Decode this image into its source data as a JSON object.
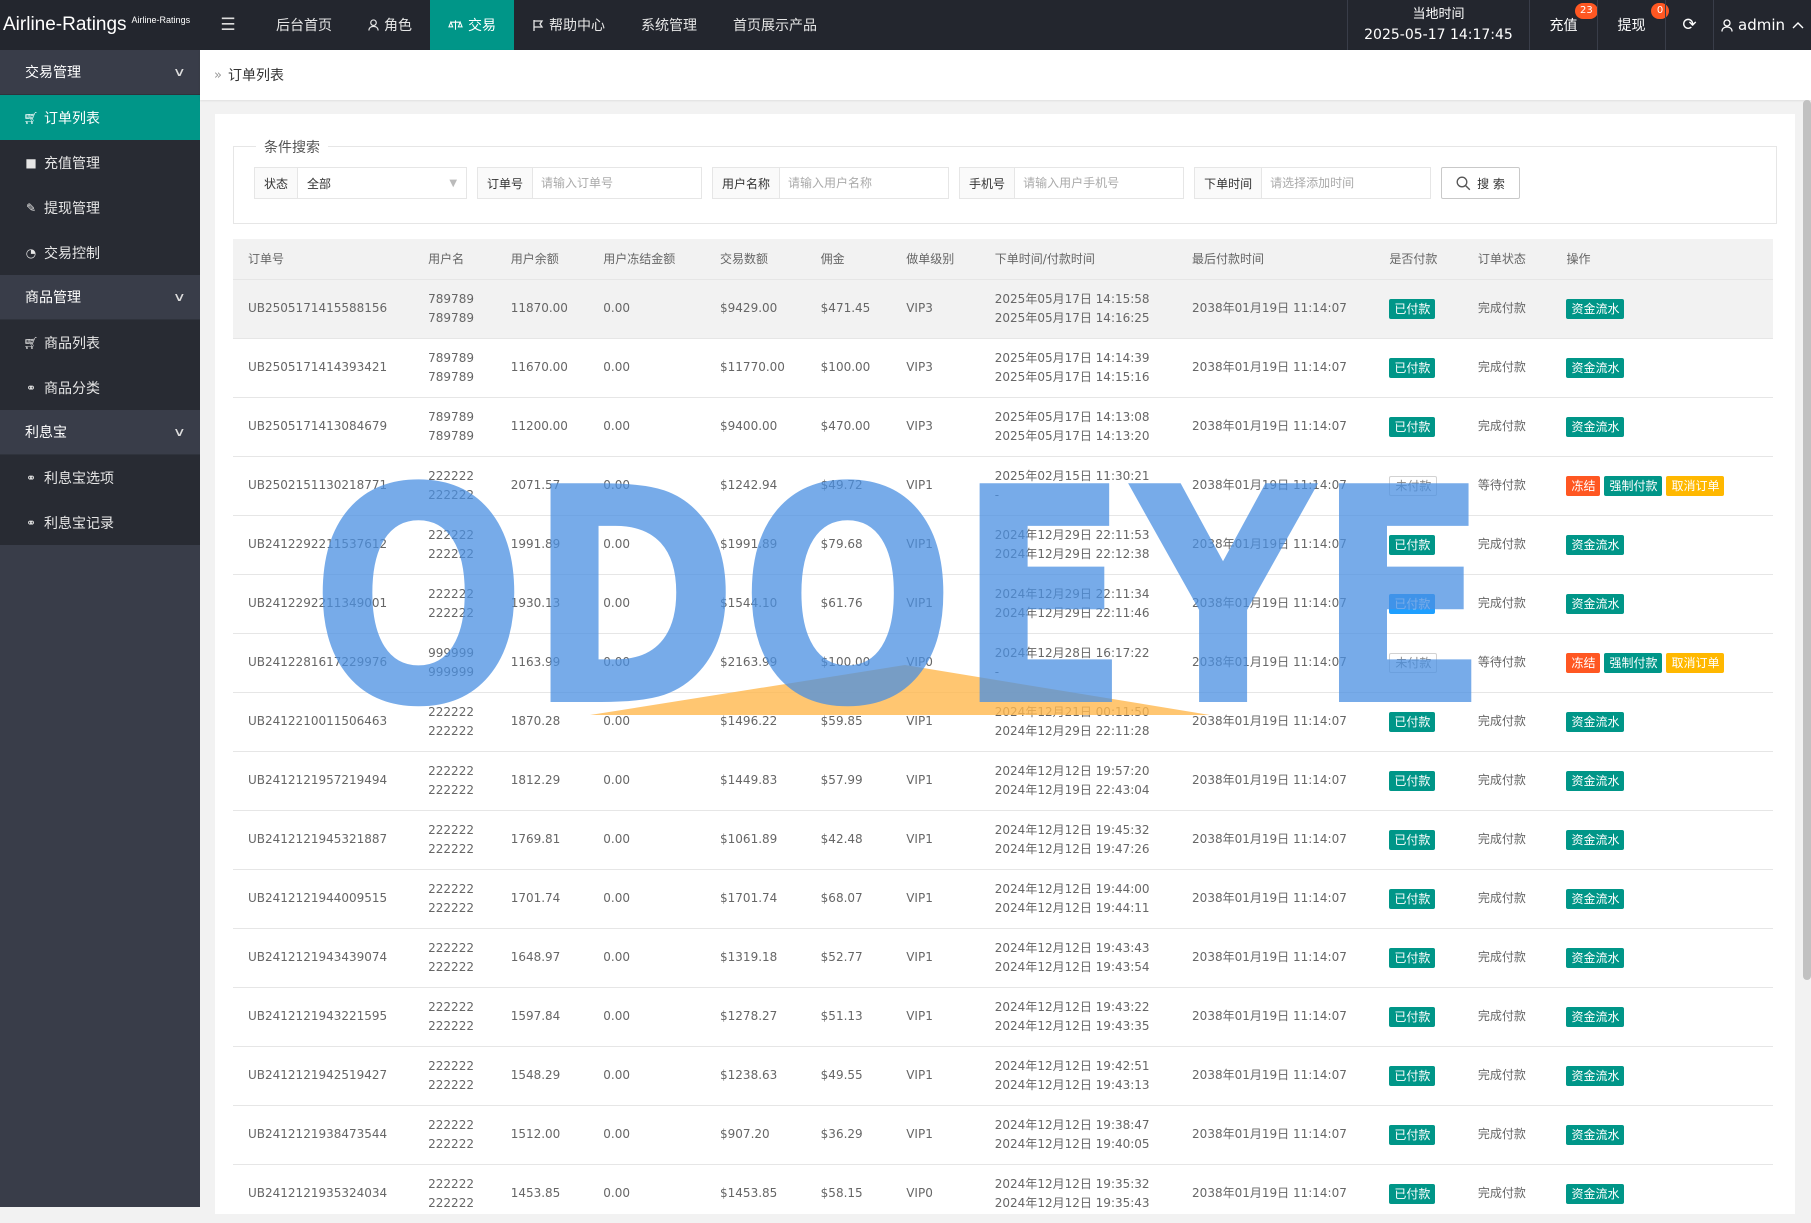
{
  "app": {
    "title": "Airline-Ratings",
    "subtitle": "Airline-Ratings"
  },
  "topnav": {
    "items": [
      {
        "label": "后台首页",
        "icon": "none"
      },
      {
        "label": "角色",
        "icon": "user-icon"
      },
      {
        "label": "交易",
        "icon": "scale-icon",
        "active": true
      },
      {
        "label": "帮助中心",
        "icon": "flag-icon"
      },
      {
        "label": "系统管理",
        "icon": "none"
      },
      {
        "label": "首页展示产品",
        "icon": "none"
      }
    ],
    "clock_label": "当地时间",
    "clock_value": "2025-05-17 14:17:45",
    "recharge_label": "充值",
    "recharge_badge": "23",
    "withdraw_label": "提现",
    "withdraw_badge": "0",
    "admin_label": "admin"
  },
  "sidebar": {
    "groups": [
      {
        "label": "交易管理",
        "items": [
          {
            "label": "订单列表",
            "icon": "cart-icon",
            "active": true
          },
          {
            "label": "充值管理",
            "icon": "comment-icon"
          },
          {
            "label": "提现管理",
            "icon": "wrench-icon"
          },
          {
            "label": "交易控制",
            "icon": "gauge-icon"
          }
        ]
      },
      {
        "label": "商品管理",
        "items": [
          {
            "label": "商品列表",
            "icon": "cart-icon"
          },
          {
            "label": "商品分类",
            "icon": "link-icon"
          }
        ]
      },
      {
        "label": "利息宝",
        "items": [
          {
            "label": "利息宝选项",
            "icon": "link-icon"
          },
          {
            "label": "利息宝记录",
            "icon": "link-icon"
          }
        ]
      }
    ]
  },
  "breadcrumb": {
    "current": "订单列表"
  },
  "filter": {
    "legend": "条件搜索",
    "status_label": "状态",
    "status_value": "全部",
    "order_label": "订单号",
    "order_placeholder": "请输入订单号",
    "username_label": "用户名称",
    "username_placeholder": "请输入用户名称",
    "phone_label": "手机号",
    "phone_placeholder": "请输入用户手机号",
    "time_label": "下单时间",
    "time_placeholder": "请选择添加时间",
    "search_label": "搜 索"
  },
  "table": {
    "headers": [
      "订单号",
      "用户名",
      "用户余额",
      "用户冻结金额",
      "交易数额",
      "佣金",
      "做单级别",
      "下单时间/付款时间",
      "最后付款时间",
      "是否付款",
      "订单状态",
      "操作"
    ],
    "rows": [
      {
        "order": "UB2505171415588156",
        "user1": "789789",
        "user2": "789789",
        "balance": "11870.00",
        "frozen": "0.00",
        "amount": "$9429.00",
        "commission": "$471.45",
        "level": "VIP3",
        "t1": "2025年05月17日 14:15:58",
        "t2": "2025年05月17日 14:16:25",
        "last": "2038年01月19日 11:14:07",
        "paid": "已付款",
        "paid_style": "green",
        "status": "完成付款",
        "actions": [
          {
            "label": "资金流水",
            "style": "green"
          }
        ]
      },
      {
        "order": "UB2505171414393421",
        "user1": "789789",
        "user2": "789789",
        "balance": "11670.00",
        "frozen": "0.00",
        "amount": "$11770.00",
        "commission": "$100.00",
        "level": "VIP3",
        "t1": "2025年05月17日 14:14:39",
        "t2": "2025年05月17日 14:15:16",
        "last": "2038年01月19日 11:14:07",
        "paid": "已付款",
        "paid_style": "green",
        "status": "完成付款",
        "actions": [
          {
            "label": "资金流水",
            "style": "green"
          }
        ]
      },
      {
        "order": "UB2505171413084679",
        "user1": "789789",
        "user2": "789789",
        "balance": "11200.00",
        "frozen": "0.00",
        "amount": "$9400.00",
        "commission": "$470.00",
        "level": "VIP3",
        "t1": "2025年05月17日 14:13:08",
        "t2": "2025年05月17日 14:13:20",
        "last": "2038年01月19日 11:14:07",
        "paid": "已付款",
        "paid_style": "green",
        "status": "完成付款",
        "actions": [
          {
            "label": "资金流水",
            "style": "green"
          }
        ]
      },
      {
        "order": "UB2502151130218771",
        "user1": "222222",
        "user2": "222222",
        "balance": "2071.57",
        "frozen": "0.00",
        "amount": "$1242.94",
        "commission": "$49.72",
        "level": "VIP1",
        "t1": "2025年02月15日 11:30:21",
        "t2": "-",
        "last": "2038年01月19日 11:14:07",
        "paid": "未付款",
        "paid_style": "gray",
        "status": "等待付款",
        "actions": [
          {
            "label": "冻结",
            "style": "orange"
          },
          {
            "label": "强制付款",
            "style": "green"
          },
          {
            "label": "取消订单",
            "style": "yellow"
          }
        ]
      },
      {
        "order": "UB2412292211537612",
        "user1": "222222",
        "user2": "222222",
        "balance": "1991.89",
        "frozen": "0.00",
        "amount": "$1991.89",
        "commission": "$79.68",
        "level": "VIP1",
        "t1": "2024年12月29日 22:11:53",
        "t2": "2024年12月29日 22:12:38",
        "last": "2038年01月19日 11:14:07",
        "paid": "已付款",
        "paid_style": "green",
        "status": "完成付款",
        "actions": [
          {
            "label": "资金流水",
            "style": "green"
          }
        ]
      },
      {
        "order": "UB2412292211349001",
        "user1": "222222",
        "user2": "222222",
        "balance": "1930.13",
        "frozen": "0.00",
        "amount": "$1544.10",
        "commission": "$61.76",
        "level": "VIP1",
        "t1": "2024年12月29日 22:11:34",
        "t2": "2024年12月29日 22:11:46",
        "last": "2038年01月19日 11:14:07",
        "paid": "已付款",
        "paid_style": "blue",
        "status": "完成付款",
        "actions": [
          {
            "label": "资金流水",
            "style": "green"
          }
        ]
      },
      {
        "order": "UB2412281617229976",
        "user1": "999999",
        "user2": "999999",
        "balance": "1163.99",
        "frozen": "0.00",
        "amount": "$2163.99",
        "commission": "$100.00",
        "level": "VIP0",
        "t1": "2024年12月28日 16:17:22",
        "t2": "-",
        "last": "2038年01月19日 11:14:07",
        "paid": "未付款",
        "paid_style": "gray",
        "status": "等待付款",
        "actions": [
          {
            "label": "冻结",
            "style": "orange"
          },
          {
            "label": "强制付款",
            "style": "green"
          },
          {
            "label": "取消订单",
            "style": "yellow"
          }
        ]
      },
      {
        "order": "UB2412210011506463",
        "user1": "222222",
        "user2": "222222",
        "balance": "1870.28",
        "frozen": "0.00",
        "amount": "$1496.22",
        "commission": "$59.85",
        "level": "VIP1",
        "t1": "2024年12月21日 00:11:50",
        "t2": "2024年12月29日 22:11:28",
        "last": "2038年01月19日 11:14:07",
        "paid": "已付款",
        "paid_style": "green",
        "status": "完成付款",
        "actions": [
          {
            "label": "资金流水",
            "style": "green"
          }
        ]
      },
      {
        "order": "UB2412121957219494",
        "user1": "222222",
        "user2": "222222",
        "balance": "1812.29",
        "frozen": "0.00",
        "amount": "$1449.83",
        "commission": "$57.99",
        "level": "VIP1",
        "t1": "2024年12月12日 19:57:20",
        "t2": "2024年12月19日 22:43:04",
        "last": "2038年01月19日 11:14:07",
        "paid": "已付款",
        "paid_style": "green",
        "status": "完成付款",
        "actions": [
          {
            "label": "资金流水",
            "style": "green"
          }
        ]
      },
      {
        "order": "UB2412121945321887",
        "user1": "222222",
        "user2": "222222",
        "balance": "1769.81",
        "frozen": "0.00",
        "amount": "$1061.89",
        "commission": "$42.48",
        "level": "VIP1",
        "t1": "2024年12月12日 19:45:32",
        "t2": "2024年12月12日 19:47:26",
        "last": "2038年01月19日 11:14:07",
        "paid": "已付款",
        "paid_style": "green",
        "status": "完成付款",
        "actions": [
          {
            "label": "资金流水",
            "style": "green"
          }
        ]
      },
      {
        "order": "UB2412121944009515",
        "user1": "222222",
        "user2": "222222",
        "balance": "1701.74",
        "frozen": "0.00",
        "amount": "$1701.74",
        "commission": "$68.07",
        "level": "VIP1",
        "t1": "2024年12月12日 19:44:00",
        "t2": "2024年12月12日 19:44:11",
        "last": "2038年01月19日 11:14:07",
        "paid": "已付款",
        "paid_style": "green",
        "status": "完成付款",
        "actions": [
          {
            "label": "资金流水",
            "style": "green"
          }
        ]
      },
      {
        "order": "UB2412121943439074",
        "user1": "222222",
        "user2": "222222",
        "balance": "1648.97",
        "frozen": "0.00",
        "amount": "$1319.18",
        "commission": "$52.77",
        "level": "VIP1",
        "t1": "2024年12月12日 19:43:43",
        "t2": "2024年12月12日 19:43:54",
        "last": "2038年01月19日 11:14:07",
        "paid": "已付款",
        "paid_style": "green",
        "status": "完成付款",
        "actions": [
          {
            "label": "资金流水",
            "style": "green"
          }
        ]
      },
      {
        "order": "UB2412121943221595",
        "user1": "222222",
        "user2": "222222",
        "balance": "1597.84",
        "frozen": "0.00",
        "amount": "$1278.27",
        "commission": "$51.13",
        "level": "VIP1",
        "t1": "2024年12月12日 19:43:22",
        "t2": "2024年12月12日 19:43:35",
        "last": "2038年01月19日 11:14:07",
        "paid": "已付款",
        "paid_style": "green",
        "status": "完成付款",
        "actions": [
          {
            "label": "资金流水",
            "style": "green"
          }
        ]
      },
      {
        "order": "UB2412121942519427",
        "user1": "222222",
        "user2": "222222",
        "balance": "1548.29",
        "frozen": "0.00",
        "amount": "$1238.63",
        "commission": "$49.55",
        "level": "VIP1",
        "t1": "2024年12月12日 19:42:51",
        "t2": "2024年12月12日 19:43:13",
        "last": "2038年01月19日 11:14:07",
        "paid": "已付款",
        "paid_style": "green",
        "status": "完成付款",
        "actions": [
          {
            "label": "资金流水",
            "style": "green"
          }
        ]
      },
      {
        "order": "UB2412121938473544",
        "user1": "222222",
        "user2": "222222",
        "balance": "1512.00",
        "frozen": "0.00",
        "amount": "$907.20",
        "commission": "$36.29",
        "level": "VIP1",
        "t1": "2024年12月12日 19:38:47",
        "t2": "2024年12月12日 19:40:05",
        "last": "2038年01月19日 11:14:07",
        "paid": "已付款",
        "paid_style": "green",
        "status": "完成付款",
        "actions": [
          {
            "label": "资金流水",
            "style": "green"
          }
        ]
      },
      {
        "order": "UB2412121935324034",
        "user1": "222222",
        "user2": "222222",
        "balance": "1453.85",
        "frozen": "0.00",
        "amount": "$1453.85",
        "commission": "$58.15",
        "level": "VIP0",
        "t1": "2024年12月12日 19:35:32",
        "t2": "2024年12月12日 19:35:43",
        "last": "2038年01月19日 11:14:07",
        "paid": "已付款",
        "paid_style": "green",
        "status": "完成付款",
        "actions": [
          {
            "label": "资金流水",
            "style": "green"
          }
        ]
      }
    ]
  },
  "watermark": {
    "text": "ODOEYE"
  },
  "colors": {
    "accent": "#009688",
    "topbar": "#23262e",
    "sidebar": "#393d49",
    "watermark": "#4a90e2",
    "watermark_triangle": "#ffb84d"
  }
}
